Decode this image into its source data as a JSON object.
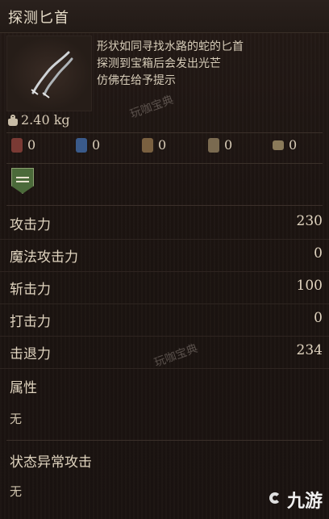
{
  "item": {
    "name": "探测匕首",
    "description": [
      "形状如同寻找水路的蛇的匕首",
      "探测到宝箱后会发出光芒",
      "仿佛在给予提示"
    ],
    "weight": "2.40 kg"
  },
  "requirements": [
    {
      "icon": "strength-icon",
      "value": "0",
      "color": "#7a3a34"
    },
    {
      "icon": "dexterity-icon",
      "value": "0",
      "color": "#3a5a8a"
    },
    {
      "icon": "intelligence-icon",
      "value": "0",
      "color": "#7a6040"
    },
    {
      "icon": "faith-icon",
      "value": "0",
      "color": "#7a6a50"
    },
    {
      "icon": "chest-icon",
      "value": "0",
      "color": "#8a7a5a"
    }
  ],
  "stats": [
    {
      "label": "攻击力",
      "value": "230"
    },
    {
      "label": "魔法攻击力",
      "value": "0"
    },
    {
      "label": "斩击力",
      "value": "100"
    },
    {
      "label": "打击力",
      "value": "0"
    },
    {
      "label": "击退力",
      "value": "234"
    }
  ],
  "attribute": {
    "label": "属性",
    "value": "无"
  },
  "status_attack": {
    "label": "状态异常攻击",
    "value": "无"
  },
  "watermarks": [
    "玩咖宝典",
    "玩咖宝典"
  ],
  "logo": "九游"
}
